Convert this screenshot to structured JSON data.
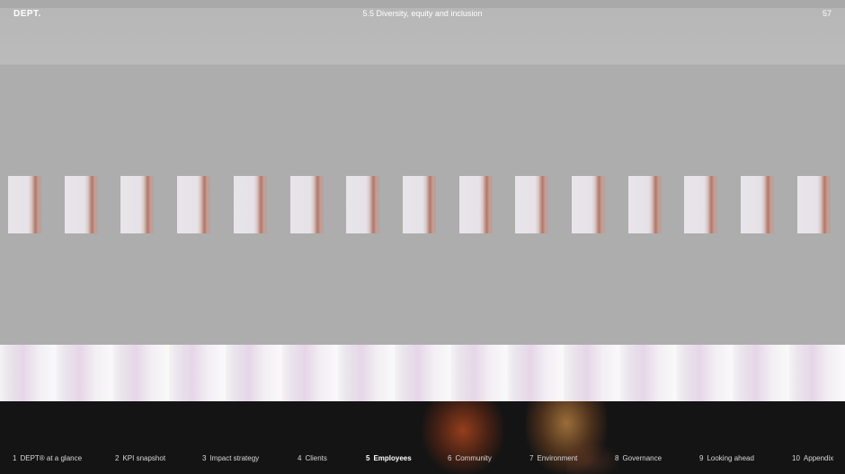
{
  "header": {
    "logo": "DEPT.",
    "section_title": "5.5 Diversity, equity and inclusion",
    "page_number": "57"
  },
  "nav": {
    "items": [
      {
        "num": "1",
        "label": "DEPT® at a glance"
      },
      {
        "num": "2",
        "label": "KPI snapshot"
      },
      {
        "num": "3",
        "label": "Impact strategy"
      },
      {
        "num": "4",
        "label": "Clients"
      },
      {
        "num": "5",
        "label": "Employees"
      },
      {
        "num": "6",
        "label": "Community"
      },
      {
        "num": "7",
        "label": "Environment"
      },
      {
        "num": "8",
        "label": "Governance"
      },
      {
        "num": "9",
        "label": "Looking ahead"
      },
      {
        "num": "10",
        "label": "Appendix"
      }
    ],
    "active_index": 4
  },
  "colors": {
    "background": "#adadad",
    "footer": "#141414",
    "text": "#ffffff"
  }
}
